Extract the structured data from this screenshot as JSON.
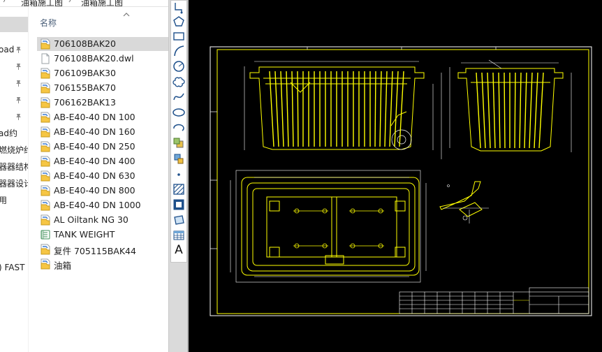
{
  "explorer": {
    "breadcrumb": [
      "油箱施工图",
      "油箱施工图"
    ],
    "column_header": "名称",
    "nav_items": [
      {
        "label": "",
        "selected": true,
        "pinned": false
      },
      {
        "label": "oad",
        "selected": false,
        "pinned": true
      },
      {
        "label": "",
        "selected": false,
        "pinned": true
      },
      {
        "label": "",
        "selected": false,
        "pinned": true
      },
      {
        "label": "",
        "selected": false,
        "pinned": true
      },
      {
        "label": "",
        "selected": false,
        "pinned": true
      },
      {
        "label": "ad约",
        "selected": false,
        "pinned": false
      },
      {
        "label": "燃烧炉约",
        "selected": false,
        "pinned": false
      },
      {
        "label": "器器结构",
        "selected": false,
        "pinned": false
      },
      {
        "label": "器器设计",
        "selected": false,
        "pinned": false
      },
      {
        "label": "用",
        "selected": false,
        "pinned": false
      },
      {
        "label": "",
        "selected": false,
        "pinned": false
      },
      {
        "label": ") FAST",
        "selected": false,
        "pinned": false
      }
    ],
    "files": [
      {
        "name": "706108BAK20",
        "icon": "cad-file-icon",
        "selected": true
      },
      {
        "name": "706108BAK20.dwl",
        "icon": "blank-file-icon",
        "selected": false
      },
      {
        "name": "706109BAK30",
        "icon": "cad-file-icon",
        "selected": false
      },
      {
        "name": "706155BAK70",
        "icon": "cad-file-icon",
        "selected": false
      },
      {
        "name": "706162BAK13",
        "icon": "cad-file-icon",
        "selected": false
      },
      {
        "name": "AB-E40-40 DN 100",
        "icon": "cad-file-icon",
        "selected": false
      },
      {
        "name": "AB-E40-40 DN 160",
        "icon": "cad-file-icon",
        "selected": false
      },
      {
        "name": "AB-E40-40 DN 250",
        "icon": "cad-file-icon",
        "selected": false
      },
      {
        "name": "AB-E40-40 DN 400",
        "icon": "cad-file-icon",
        "selected": false
      },
      {
        "name": "AB-E40-40 DN 630",
        "icon": "cad-file-icon",
        "selected": false
      },
      {
        "name": "AB-E40-40 DN 800",
        "icon": "cad-file-icon",
        "selected": false
      },
      {
        "name": "AB-E40-40 DN 1000",
        "icon": "cad-file-icon",
        "selected": false
      },
      {
        "name": "AL Oiltank NG 30",
        "icon": "cad-file-icon",
        "selected": false
      },
      {
        "name": "TANK WEIGHT",
        "icon": "spreadsheet-file-icon",
        "selected": false
      },
      {
        "name": "复件 705115BAK44",
        "icon": "cad-file-icon",
        "selected": false
      },
      {
        "name": "油箱",
        "icon": "cad-file-icon",
        "selected": false
      }
    ]
  },
  "toolbar": {
    "tools": [
      "polyline-tool-icon",
      "polygon-tool-icon",
      "rectangle-tool-icon",
      "arc-tool-icon",
      "circle-tool-icon",
      "revision-cloud-tool-icon",
      "spline-tool-icon",
      "ellipse-tool-icon",
      "ellipse-arc-tool-icon",
      "insert-block-tool-icon",
      "make-block-tool-icon",
      "point-tool-icon",
      "hatch-tool-icon",
      "gradient-tool-icon",
      "region-tool-icon",
      "table-tool-icon",
      "multiline-text-tool-icon"
    ],
    "text_tool_glyph": "A"
  },
  "colors": {
    "canvas_bg": "#000000",
    "drawing_yellow": "#ffff00",
    "drawing_white": "#ffffff",
    "selection_bg": "#d9d9d9",
    "folder_yellow": "#f6c644"
  }
}
